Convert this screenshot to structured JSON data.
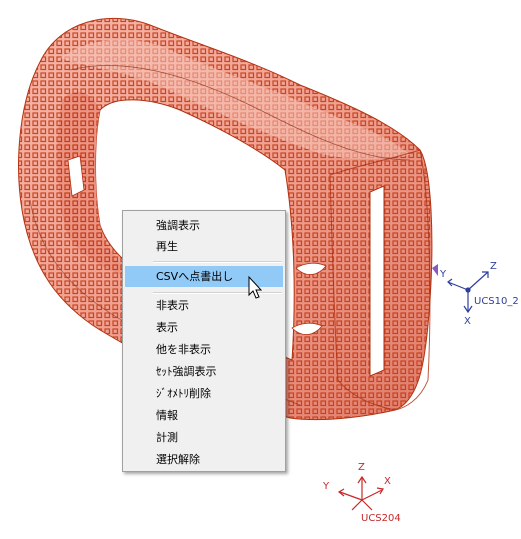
{
  "colors": {
    "model_fill": "#f0a090",
    "model_shade": "#d0604c",
    "marker": "#c43a14",
    "triad_blue": "#2f3f9a",
    "triad_red": "#c82828",
    "menu_bg": "#f0f0f0",
    "menu_highlight": "#91c9f7"
  },
  "context_menu": {
    "items": [
      {
        "label": "強調表示"
      },
      {
        "label": "再生"
      },
      {
        "label": "CSVへ点書出し",
        "highlighted": true
      },
      {
        "label": "非表示"
      },
      {
        "label": "表示"
      },
      {
        "label": "他を非表示"
      },
      {
        "label": "ｾｯﾄ強調表示"
      },
      {
        "label": "ｼﾞｵﾒﾄﾘ削除"
      },
      {
        "label": "情報"
      },
      {
        "label": "計測"
      },
      {
        "label": "選択解除"
      }
    ]
  },
  "triad_blue": {
    "name": "UCS10_2",
    "x": "X",
    "y": "Y",
    "z": "Z"
  },
  "triad_red": {
    "name": "UCS204",
    "x": "X",
    "y": "Y",
    "z": "Z"
  },
  "icons": {
    "cursor": "arrow-cursor-icon"
  }
}
